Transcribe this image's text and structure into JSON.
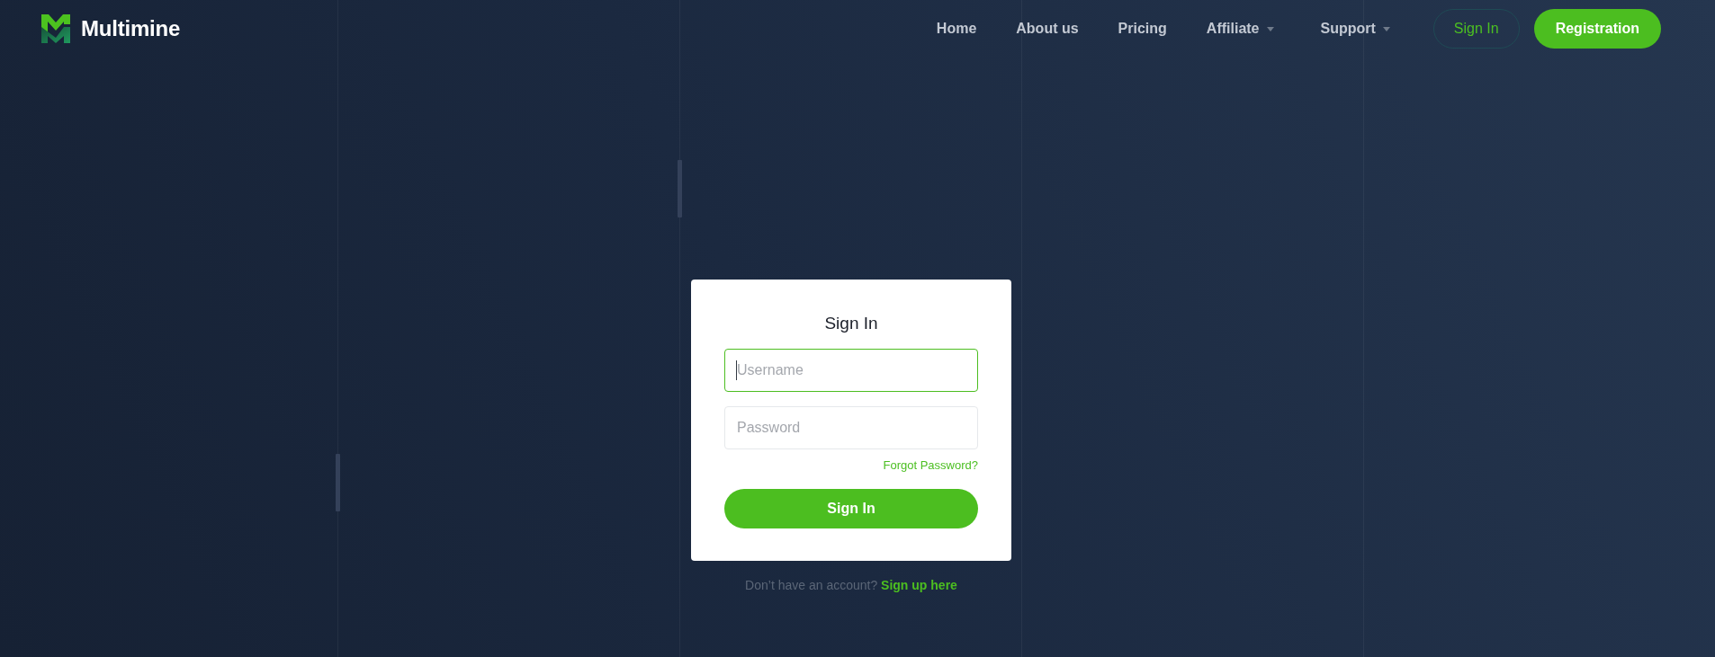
{
  "header": {
    "logo": {
      "text": "Multimine"
    },
    "nav": [
      {
        "label": "Home",
        "kind": "link"
      },
      {
        "label": "About us",
        "kind": "link"
      },
      {
        "label": "Pricing",
        "kind": "link"
      },
      {
        "label": "Affiliate",
        "kind": "dropdown"
      },
      {
        "label": "Support",
        "kind": "dropdown"
      }
    ],
    "buttons": [
      {
        "label": "Sign In",
        "kind": "outline"
      },
      {
        "label": "Registration",
        "kind": "filled"
      }
    ]
  },
  "login_card": {
    "title": "Sign In",
    "fields": [
      {
        "placeholder": "Username",
        "focused": true
      },
      {
        "placeholder": "Password",
        "focused": false
      }
    ],
    "forgot_link": "Forgot Password?",
    "submit_button": "Sign In"
  },
  "signup_prompt": {
    "text": "Don’t have an account?",
    "link": "Sign up here"
  }
}
